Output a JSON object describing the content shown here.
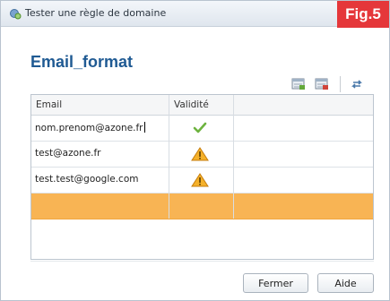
{
  "window": {
    "title": "Tester une règle de domaine",
    "badge": "Fig.5"
  },
  "heading": "Email_format",
  "toolbar": {
    "icons": [
      "import-icon",
      "export-icon",
      "refresh-icon"
    ]
  },
  "table": {
    "columns": [
      "Email",
      "Validité"
    ],
    "rows": [
      {
        "email": "nom.prenom@azone.fr",
        "status": "valid"
      },
      {
        "email": "test@azone.fr",
        "status": "warning"
      },
      {
        "email": "test.test@google.com",
        "status": "warning"
      },
      {
        "email": "",
        "status": ""
      }
    ],
    "colors": {
      "selected_row": "#f8b454",
      "valid": "#6db33f",
      "warning": "#f0a020"
    }
  },
  "buttons": {
    "close": "Fermer",
    "help": "Aide"
  }
}
